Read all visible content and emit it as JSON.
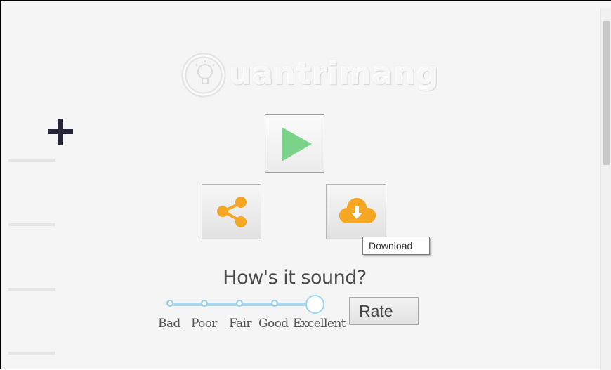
{
  "watermark": {
    "text": "uantrimang"
  },
  "buttons": {
    "play_icon": "play-icon",
    "share_icon": "share-icon",
    "download_icon": "cloud-download-icon",
    "play_color": "#7bd389",
    "action_color": "#f5a623"
  },
  "tooltip": {
    "text": "Download"
  },
  "rating": {
    "question": "How's it sound?",
    "labels": [
      "Bad",
      "Poor",
      "Fair",
      "Good",
      "Excellent"
    ],
    "selected": "Excellent",
    "accent": "#a9d9f0"
  },
  "rate_button": {
    "label": "Rate"
  }
}
